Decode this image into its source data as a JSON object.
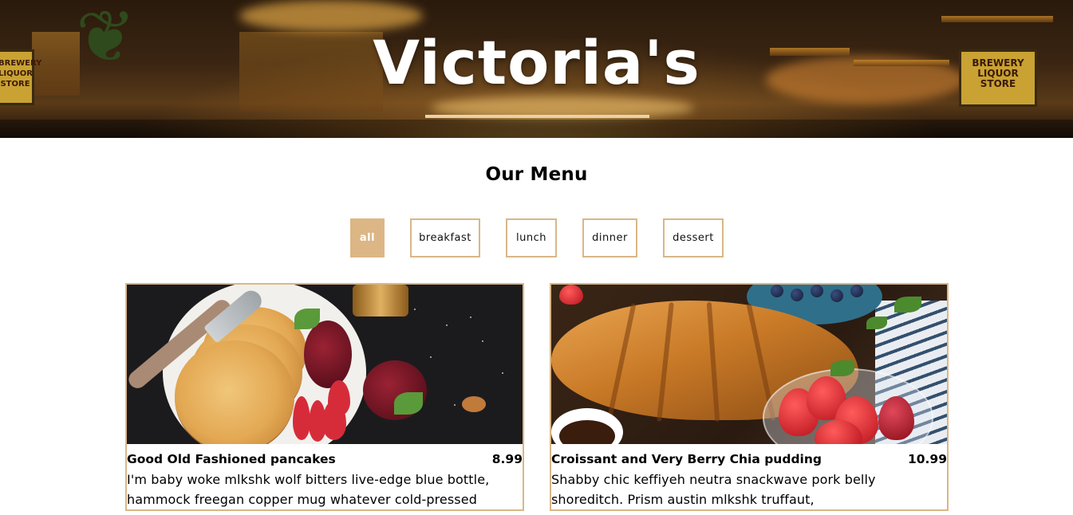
{
  "hero": {
    "title": "Victoria's",
    "left_sign": "BREWERY\nLIQUOR\nSTORE",
    "right_sign": "BREWERY\nLIQUOR\nSTORE"
  },
  "menu": {
    "title": "Our Menu"
  },
  "filters": [
    {
      "label": "all",
      "active": true
    },
    {
      "label": "breakfast",
      "active": false
    },
    {
      "label": "lunch",
      "active": false
    },
    {
      "label": "dinner",
      "active": false
    },
    {
      "label": "dessert",
      "active": false
    }
  ],
  "items": [
    {
      "name": "Good Old Fashioned pancakes",
      "price": "8.99",
      "description": "I'm baby woke mlkshk wolf bitters live-edge blue bottle, hammock freegan copper mug whatever cold-pressed",
      "image": "pancakes-photo"
    },
    {
      "name": "Croissant and Very Berry Chia pudding",
      "price": "10.99",
      "description": "Shabby chic keffiyeh neutra snackwave pork belly shoreditch. Prism austin mlkshk truffaut,",
      "image": "croissant-photo"
    }
  ],
  "colors": {
    "accent": "#dcb685",
    "border": "#d9b787",
    "underline": "#e9d2a7"
  }
}
